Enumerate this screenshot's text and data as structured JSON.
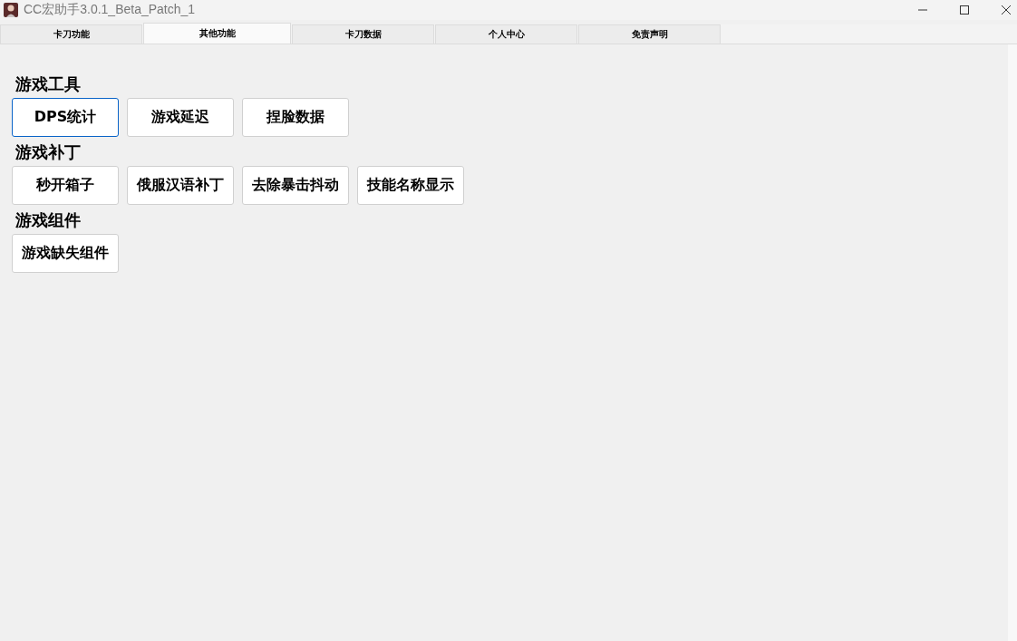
{
  "window": {
    "title": "CC宏助手3.0.1_Beta_Patch_1"
  },
  "tabs": [
    {
      "label": "卡刀功能",
      "selected": false
    },
    {
      "label": "其他功能",
      "selected": true
    },
    {
      "label": "卡刀数据",
      "selected": false
    },
    {
      "label": "个人中心",
      "selected": false
    },
    {
      "label": "免责声明",
      "selected": false
    }
  ],
  "sections": [
    {
      "title": "游戏工具",
      "buttons": [
        {
          "label": "DPS统计",
          "focused": true
        },
        {
          "label": "游戏延迟",
          "focused": false
        },
        {
          "label": "捏脸数据",
          "focused": false
        }
      ]
    },
    {
      "title": "游戏补丁",
      "buttons": [
        {
          "label": "秒开箱子",
          "focused": false
        },
        {
          "label": "俄服汉语补丁",
          "focused": false
        },
        {
          "label": "去除暴击抖动",
          "focused": false
        },
        {
          "label": "技能名称显示",
          "focused": false
        }
      ]
    },
    {
      "title": "游戏组件",
      "buttons": [
        {
          "label": "游戏缺失组件",
          "focused": false
        }
      ]
    }
  ]
}
